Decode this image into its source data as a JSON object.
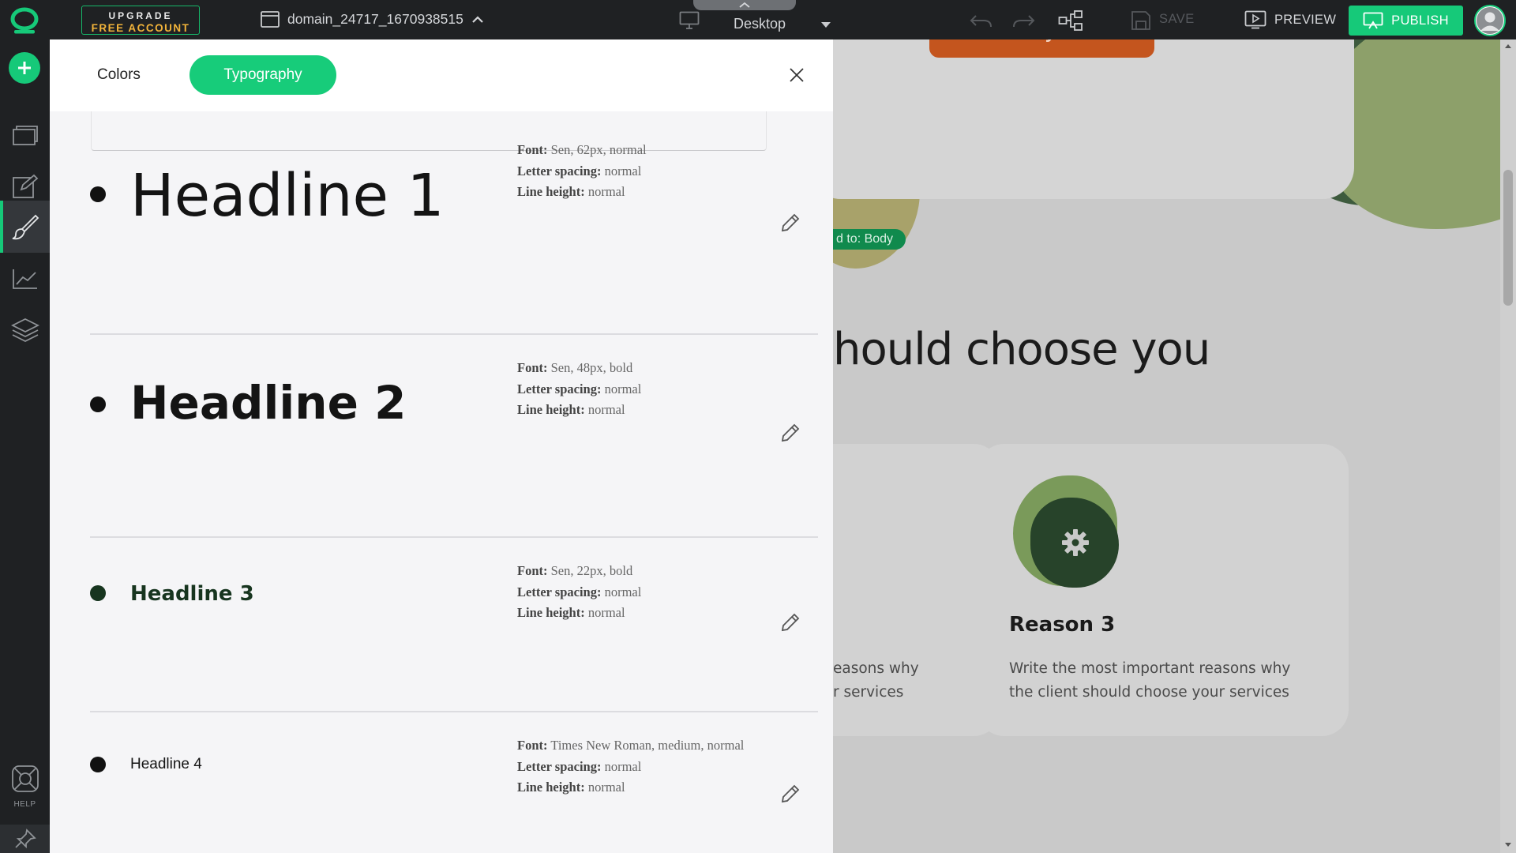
{
  "topbar": {
    "upgrade_line1": "UPGRADE",
    "upgrade_line2": "FREE ACCOUNT",
    "domain_name": "domain_24717_1670938515",
    "device_label": "Desktop",
    "save_label": "SAVE",
    "preview_label": "PREVIEW",
    "publish_label": "PUBLISH"
  },
  "sidebar": {
    "help_label": "HELP"
  },
  "panel": {
    "tabs": [
      {
        "label": "Colors",
        "active": false
      },
      {
        "label": "Typography",
        "active": true
      }
    ],
    "styles": [
      {
        "name": "Headline 1",
        "font_label": "Font:",
        "font": "Sen, 62px, normal",
        "spacing_label": "Letter spacing:",
        "spacing": "normal",
        "line_label": "Line height:",
        "line": "normal"
      },
      {
        "name": "Headline 2",
        "font_label": "Font:",
        "font": "Sen, 48px, bold",
        "spacing_label": "Letter spacing:",
        "spacing": "normal",
        "line_label": "Line height:",
        "line": "normal"
      },
      {
        "name": "Headline 3",
        "font_label": "Font:",
        "font": "Sen, 22px, bold",
        "spacing_label": "Letter spacing:",
        "spacing": "normal",
        "line_label": "Line height:",
        "line": "normal"
      },
      {
        "name": "Headline 4",
        "font_label": "Font:",
        "font": "Times New Roman, medium, normal",
        "spacing_label": "Letter spacing:",
        "spacing": "normal",
        "line_label": "Line height:",
        "line": "normal"
      }
    ]
  },
  "site": {
    "cta_label": "Primary CTA",
    "applied_tag": "d to: Body",
    "heading": "hould choose you",
    "card1_text_line1": "easons why",
    "card1_text_line2": "r services",
    "card2_title": "Reason 3",
    "card2_text_line1": "Write the most important reasons why",
    "card2_text_line2": "the client should choose your services"
  },
  "colors": {
    "accent": "#16c979",
    "topbar_bg": "#1f2123",
    "cta": "#c4551e",
    "upgrade_text": "#f2b43a"
  }
}
